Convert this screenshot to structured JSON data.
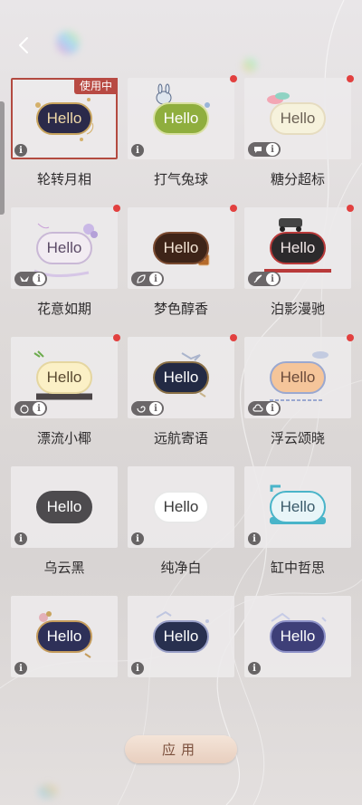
{
  "header": {
    "back_icon": "chevron-left-icon"
  },
  "selected_tag": "使用中",
  "preview_text": "Hello",
  "apply_button": "应用",
  "bubbles": [
    {
      "name": "轮转月相",
      "selected": true,
      "red_dot": false,
      "feature_icon": null,
      "bg": "#2b2a4a",
      "fg": "#f0d9a8",
      "border": "#c8a45e",
      "deco": "moon"
    },
    {
      "name": "打气兔球",
      "selected": false,
      "red_dot": true,
      "feature_icon": null,
      "bg": "#8fae3e",
      "fg": "#ffffff",
      "border": "#d8e0a0",
      "deco": "rabbit"
    },
    {
      "name": "糖分超标",
      "selected": false,
      "red_dot": true,
      "feature_icon": "message-icon",
      "bg": "#f6f2dc",
      "fg": "#6b6155",
      "border": "#e6dcc0",
      "deco": "macaron"
    },
    {
      "name": "花意如期",
      "selected": false,
      "red_dot": true,
      "feature_icon": "ribbon-icon",
      "bg": "#f2ecf2",
      "fg": "#5b4a66",
      "border": "#c9b8d6",
      "deco": "flower"
    },
    {
      "name": "梦色醇香",
      "selected": false,
      "red_dot": true,
      "feature_icon": "leaf-icon",
      "bg": "#3e2418",
      "fg": "#f5e6d6",
      "border": "#7a4a30",
      "deco": "coffee"
    },
    {
      "name": "泊影漫驰",
      "selected": false,
      "red_dot": true,
      "feature_icon": "feather-icon",
      "bg": "#2c2a2c",
      "fg": "#f2e8e8",
      "border": "#b93a3a",
      "deco": "car"
    },
    {
      "name": "漂流小椰",
      "selected": false,
      "red_dot": true,
      "feature_icon": "coconut-icon",
      "bg": "#fbf0c6",
      "fg": "#5a4a30",
      "border": "#e5d6a0",
      "deco": "coconut"
    },
    {
      "name": "远航寄语",
      "selected": false,
      "red_dot": true,
      "feature_icon": "swirl-icon",
      "bg": "#232a44",
      "fg": "#ffffff",
      "border": "#8a7046",
      "deco": "ship"
    },
    {
      "name": "浮云颂晓",
      "selected": false,
      "red_dot": true,
      "feature_icon": "cloud-icon",
      "bg": "#f5c59a",
      "fg": "#6a4a3a",
      "border": "#9aa8d0",
      "deco": "cloud"
    },
    {
      "name": "乌云黑",
      "selected": false,
      "red_dot": false,
      "feature_icon": null,
      "bg": "#4d4b4e",
      "fg": "#ffffff",
      "border": "#4d4b4e",
      "deco": "none"
    },
    {
      "name": "纯净白",
      "selected": false,
      "red_dot": false,
      "feature_icon": null,
      "bg": "#ffffff",
      "fg": "#3a3a3a",
      "border": "#e8e8e8",
      "deco": "none"
    },
    {
      "name": "缸中哲思",
      "selected": false,
      "red_dot": false,
      "feature_icon": null,
      "bg": "#e8f5f8",
      "fg": "#3a5a6a",
      "border": "#49b4c9",
      "deco": "bathtub"
    },
    {
      "name": "",
      "selected": false,
      "red_dot": false,
      "feature_icon": null,
      "bg": "#2e3058",
      "fg": "#ffffff",
      "border": "#c59c5c",
      "deco": "flower2"
    },
    {
      "name": "",
      "selected": false,
      "red_dot": false,
      "feature_icon": null,
      "bg": "#28304f",
      "fg": "#ffffff",
      "border": "#9aa0c8",
      "deco": "bird"
    },
    {
      "name": "",
      "selected": false,
      "red_dot": false,
      "feature_icon": null,
      "bg": "#3e3f78",
      "fg": "#ffffff",
      "border": "#8e92c8",
      "deco": "bird2"
    }
  ]
}
